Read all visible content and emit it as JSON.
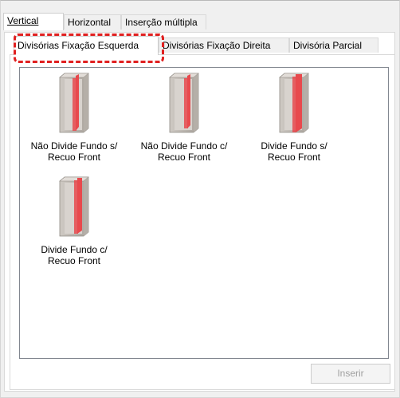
{
  "top_tabs": [
    "Vertical",
    "Horizontal",
    "Inserção múltipla"
  ],
  "sub_tabs": [
    "Divisórias Fixação Esquerda",
    "Divisórias Fixação Direita",
    "Divisória Parcial"
  ],
  "items": [
    {
      "label": "Não Divide Fundo s/\nRecuo Front",
      "icon": "cabinet-divider-icon"
    },
    {
      "label": "Não Divide Fundo c/\nRecuo Front",
      "icon": "cabinet-divider-icon"
    },
    {
      "label": "Divide Fundo s/\nRecuo Front",
      "icon": "cabinet-divider-icon"
    },
    {
      "label": "Divide Fundo c/\nRecuo Front",
      "icon": "cabinet-divider-icon"
    }
  ],
  "insert_button": "Inserir",
  "colors": {
    "divider": "#e8494d",
    "highlight": "#e02020"
  }
}
